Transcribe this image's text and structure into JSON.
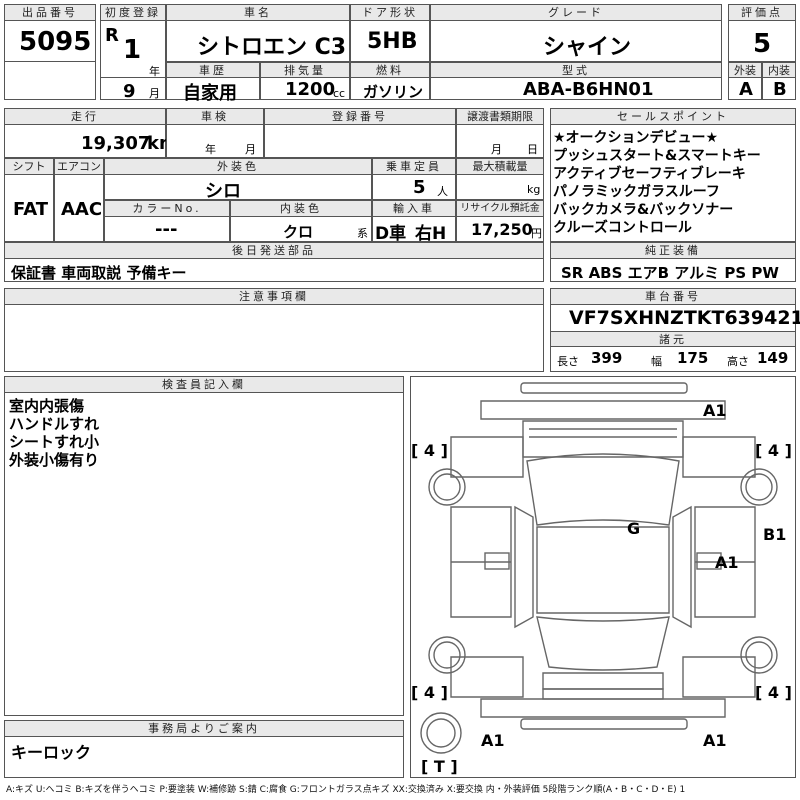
{
  "header_labels": {
    "auction_no": "出品番号",
    "first_reg": "初度登録",
    "car_name": "車名",
    "door": "ドア形状",
    "grade": "グレード",
    "score": "評価点",
    "history": "車歴",
    "displacement": "排気量",
    "fuel": "燃料",
    "model_code": "型式",
    "exterior": "外装",
    "interior": "内装",
    "mileage": "走行",
    "inspection": "車検",
    "registration": "登録番号",
    "transfer_doc": "譲渡書類期限",
    "sales_points": "セールスポイント",
    "shift": "シフト",
    "aircon": "エアコン",
    "ext_color": "外装色",
    "capacity": "乗車定員",
    "max_load": "最大積載量",
    "color_no": "カラーNo.",
    "int_color": "内装色",
    "import": "輸入車",
    "recycle": "リサイクル預託金",
    "post_parts": "後日発送部品",
    "standard_equip": "純正装備",
    "notes": "注意事項欄",
    "chassis": "車台番号",
    "specs": "諸元",
    "inspector": "検査員記入欄",
    "office": "事務局よりご案内"
  },
  "vehicle": {
    "auction_no": "5095",
    "era": "R",
    "year": "1",
    "year_unit": "年",
    "month": "9",
    "month_unit": "月",
    "car_name": "シトロエン C3",
    "door": "5HB",
    "grade": "シャイン",
    "score": "5",
    "history": "自家用",
    "displacement": "1200",
    "displacement_unit": "cc",
    "fuel": "ガソリン",
    "model_code": "ABA-B6HN01",
    "exterior_grade": "A",
    "interior_grade": "B",
    "mileage": "19,307",
    "mileage_unit": "km",
    "inspection_year_unit": "年",
    "inspection_month_unit": "月",
    "transfer_month_unit": "月",
    "transfer_day_unit": "日",
    "shift": "FAT",
    "aircon": "AAC",
    "ext_color": "シロ",
    "capacity": "5",
    "capacity_unit": "人",
    "load_unit": "kg",
    "color_no": "---",
    "int_color": "クロ",
    "int_color_suffix": "系",
    "import": "D車",
    "handle": "右H",
    "recycle": "17,250",
    "recycle_unit": "円",
    "post_parts": "保証書 車両取説 予備キー",
    "standard_equip": "SR ABS エアB アルミ PS PW",
    "chassis": "VF7SXHNZTKT639421",
    "length_label": "長さ",
    "length": "399",
    "width_label": "幅",
    "width": "175",
    "height_label": "高さ",
    "height": "149"
  },
  "sales_points": [
    "★オークションデビュー★",
    "プッシュスタート&スマートキー",
    "アクティブセーフティブレーキ",
    "パノラミックガラスルーフ",
    "バックカメラ&バックソナー",
    "クルーズコントロール"
  ],
  "inspector_notes": [
    "室内内張傷",
    "ハンドルすれ",
    "シートすれ小",
    "外装小傷有り"
  ],
  "office_note": "キーロック",
  "damage_marks": {
    "front_right": "A1",
    "tire_fl": "[ 4 ]",
    "tire_fr": "[ 4 ]",
    "roof": "G",
    "right_side": "B1",
    "right_door": "A1",
    "tire_rl": "[ 4 ]",
    "tire_rr": "[ 4 ]",
    "rear_left": "A1",
    "rear_right": "A1",
    "trunk": "[ T ]"
  },
  "legend": "A:キズ U:ヘコミ B:キズを伴うヘコミ P:要塗装 W:補修跡 S:錆 C:腐食 G:フロントガラス点キズ XX:交換済み X:要交換 内・外装評価 5段階ランク順(A・B・C・D・E) 1"
}
